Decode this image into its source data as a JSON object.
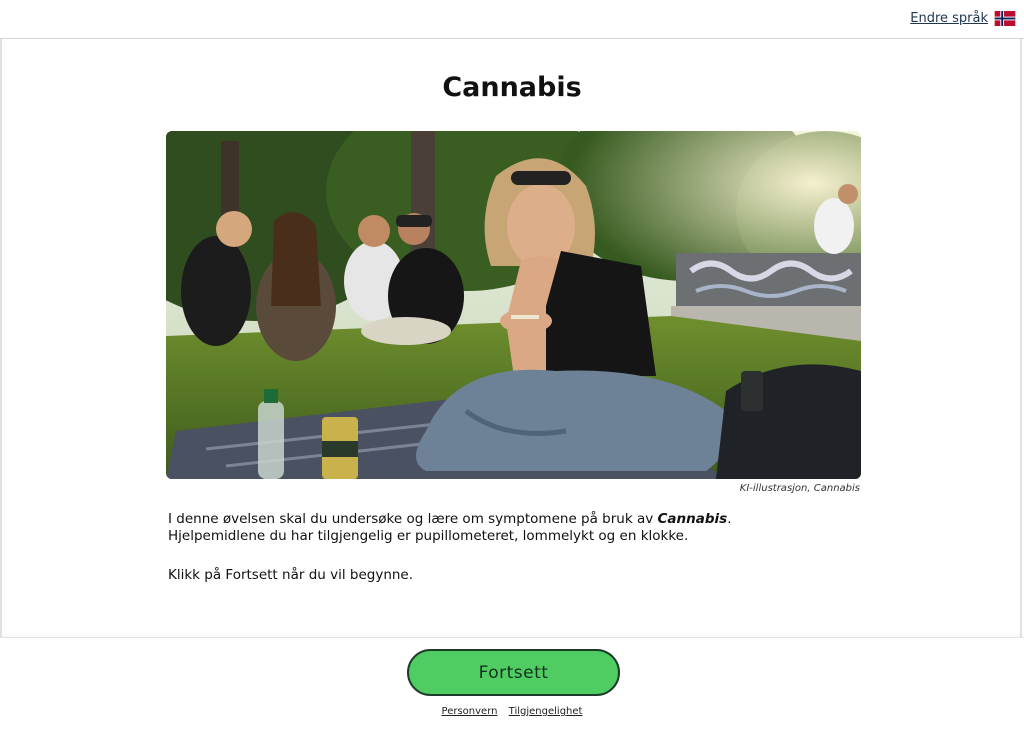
{
  "header": {
    "language_label": "Endre språk",
    "flag_icon": "norway-flag-icon"
  },
  "main": {
    "title": "Cannabis",
    "image_caption": "KI-illustrasjon, Cannabis",
    "intro_before": "I denne øvelsen skal du undersøke og lære om symptomene på bruk av ",
    "intro_emphasis": "Cannabis",
    "intro_after": ". Hjelpemidlene du har tilgjengelig er pupillometeret, lommelykt og en klokke.",
    "instruction": "Klikk på Fortsett når du vil begynne."
  },
  "footer": {
    "continue_label": "Fortsett",
    "links": [
      "Personvern",
      "Tilgjengelighet"
    ]
  },
  "colors": {
    "button_fill": "#4fcd63",
    "button_border": "#1d3a2a",
    "link_color": "#1f3550"
  }
}
